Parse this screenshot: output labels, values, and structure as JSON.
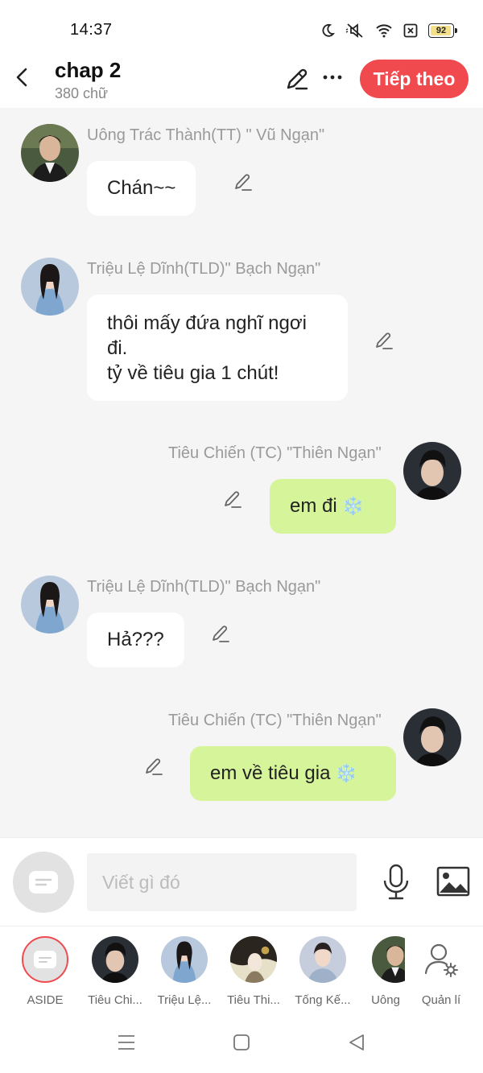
{
  "status_bar": {
    "time": "14:37",
    "battery": "92",
    "icons": [
      "moon-icon",
      "mute-icon",
      "wifi-icon",
      "sim-x-icon",
      "battery-icon"
    ]
  },
  "header": {
    "title": "chap 2",
    "subtitle": "380 chữ",
    "next_label": "Tiếp theo"
  },
  "messages": [
    {
      "speaker": "Uông Trác Thành(TT) \" Vũ Ngạn\"",
      "side": "left",
      "lines": [
        "Chán~~"
      ],
      "avatar": "tt"
    },
    {
      "speaker": "Triệu Lệ Dĩnh(TLD)\" Bạch Ngạn\"",
      "side": "left",
      "lines": [
        "thôi mấy đứa nghĩ ngơi",
        "đi.",
        "tỷ về tiêu gia 1 chút!"
      ],
      "avatar": "tld"
    },
    {
      "speaker": "Tiêu Chiến (TC)  \"Thiên Ngạn\"",
      "side": "right",
      "text": "em đi",
      "emoji": "❄️",
      "avatar": "tc"
    },
    {
      "speaker": "Triệu Lệ Dĩnh(TLD)\" Bạch Ngạn\"",
      "side": "left",
      "lines": [
        "Hả???"
      ],
      "avatar": "tld"
    },
    {
      "speaker": "Tiêu Chiến (TC)  \"Thiên Ngạn\"",
      "side": "right",
      "text": "em về tiêu gia",
      "emoji": "❄️",
      "avatar": "tc"
    }
  ],
  "input": {
    "placeholder": "Viết gì đó"
  },
  "characters": [
    {
      "label": "ASIDE"
    },
    {
      "label": "Tiêu Chi..."
    },
    {
      "label": "Triệu Lệ..."
    },
    {
      "label": "Tiêu Thi..."
    },
    {
      "label": "Tống Kế..."
    },
    {
      "label": "Uông"
    },
    {
      "label": "Quản lí"
    }
  ],
  "colors": {
    "accent": "#f04a4f",
    "bubble_right": "#d6f59a",
    "bubble_left": "#ffffff",
    "chat_bg": "#f5f5f5"
  }
}
